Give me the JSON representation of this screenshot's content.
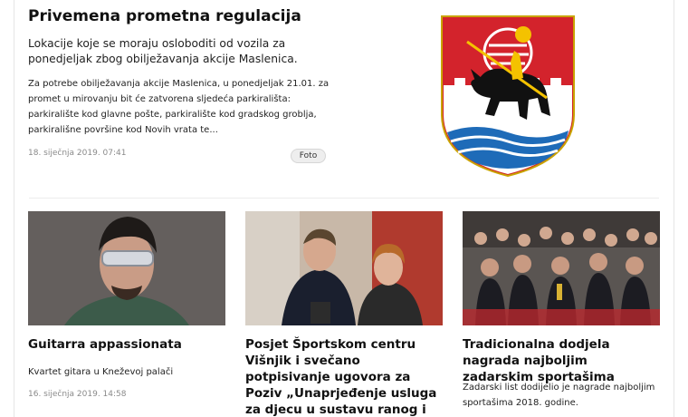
{
  "featured": {
    "title": "Privemena prometna regulacija",
    "lead": " Lokacije koje se moraju osloboditi od vozila za ponedjeljak zbog obilježavanja akcije Maslenica.",
    "body": "Za potrebe obilježavanja akcije Maslenica, u ponedjeljak 21.01. za promet u mirovanju bit će zatvorena sljedeća parkirališta: parkiralište kod glavne pošte, parkiralište kod gradskog groblja, parkirališne površine kod Novih vrata te...",
    "date": "18. siječnja 2019. 07:41",
    "foto_label": "Foto",
    "image_icon": "coat-of-arms"
  },
  "cards": [
    {
      "title": "Guitarra appassionata",
      "subtitle": "Kvartet gitara u Kneževoj palači",
      "date": "16. siječnja 2019. 14:58",
      "image_icon": "portrait-photo"
    },
    {
      "title": "Posjet Športskom centru Višnjik i svečano potpisivanje ugovora za Poziv „Unaprjeđenje usluga za djecu u sustavu ranog i predškolskog odgoja i",
      "image_icon": "ceremony-photo"
    },
    {
      "title": "Tradicionalna dodjela nagrada najboljim zadarskim sportašima",
      "subtitle": "Zadarski list dodijelio je nagrade najboljim sportašima 2018. godine.",
      "image_icon": "audience-photo"
    }
  ],
  "colors": {
    "coat_red": "#d3232c",
    "coat_blue": "#1e6bb8",
    "coat_gold": "#f4c200"
  }
}
